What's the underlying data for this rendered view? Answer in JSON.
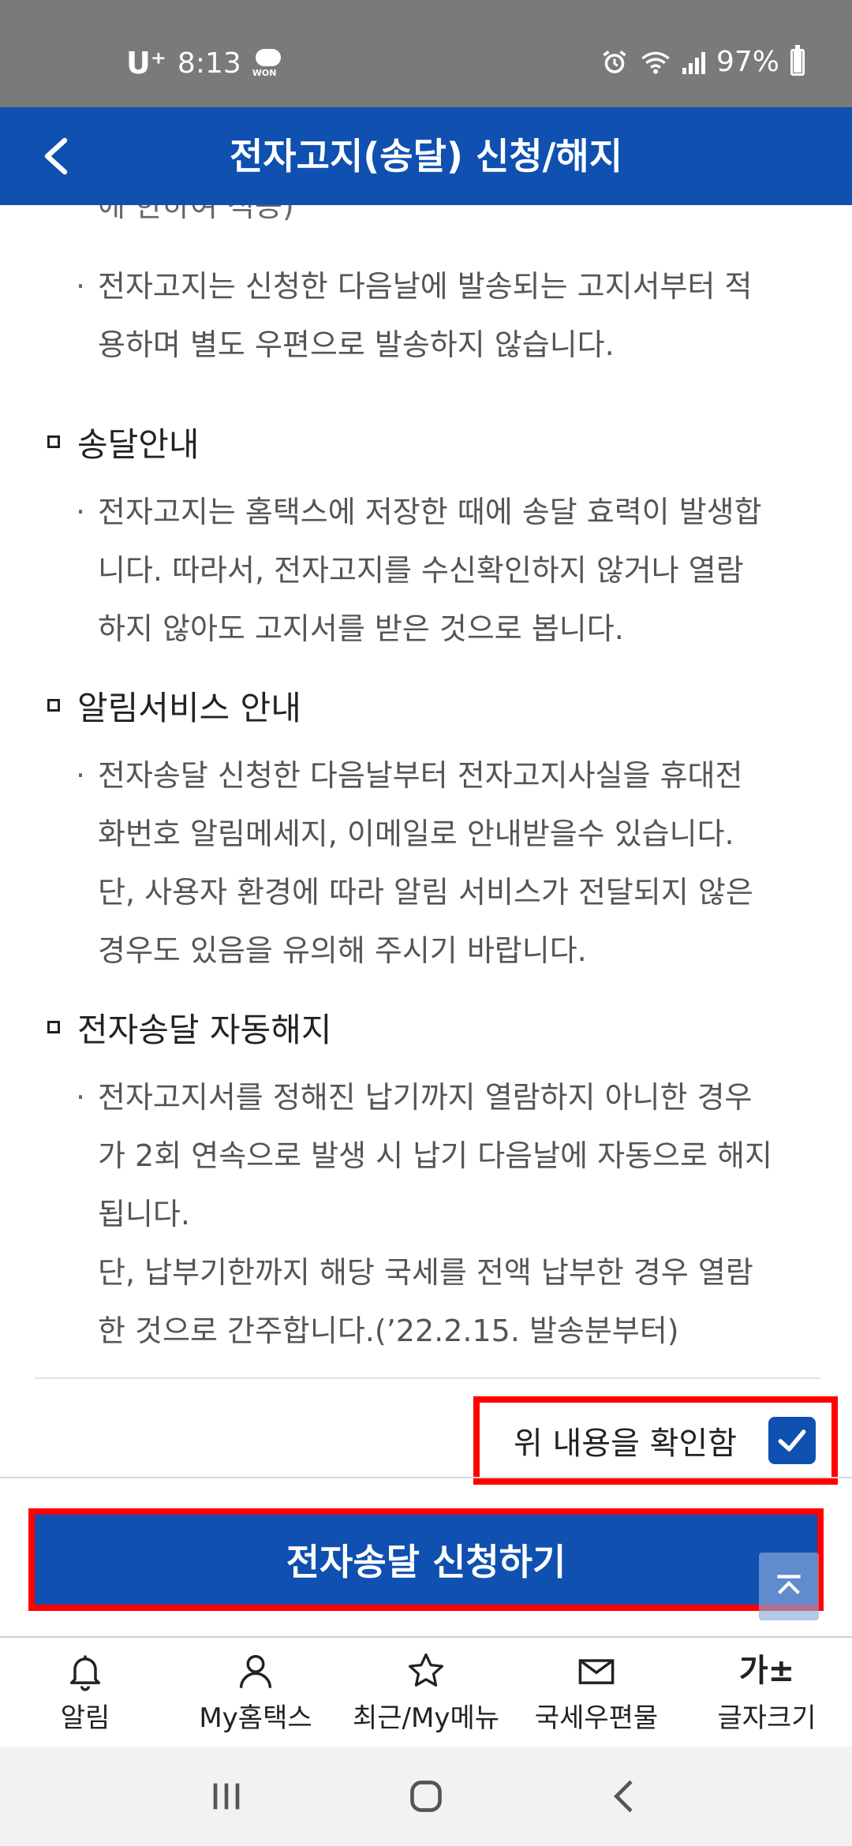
{
  "status_bar": {
    "carrier": "U⁺",
    "time": "8:13",
    "won_label": "WON",
    "battery": "97%",
    "battery_level": 0.97
  },
  "header": {
    "title": "전자고지(송달) 신청/해지"
  },
  "content": {
    "partial_line": "에 한하여 적용)",
    "intro_bullet": {
      "mark": "·",
      "lines": [
        "전자고지는 신청한 다음날에 발송되는 고지서부터 적",
        "용하며 별도 우편으로 발송하지 않습니다."
      ]
    },
    "sections": [
      {
        "title": "송달안내",
        "bullet_lines": [
          "전자고지는 홈택스에 저장한 때에 송달 효력이 발생합",
          "니다. 따라서, 전자고지를 수신확인하지 않거나 열람",
          "하지 않아도 고지서를 받은 것으로 봅니다."
        ]
      },
      {
        "title": "알림서비스 안내",
        "bullet_lines": [
          "전자송달 신청한 다음날부터 전자고지사실을 휴대전",
          "화번호 알림메세지, 이메일로 안내받을수 있습니다.",
          "단, 사용자 환경에 따라 알림 서비스가 전달되지 않은",
          "경우도 있음을 유의해 주시기 바랍니다."
        ]
      },
      {
        "title": "전자송달 자동해지",
        "bullet_lines": [
          "전자고지서를 정해진 납기까지 열람하지 아니한 경우",
          "가 2회 연속으로 발생 시 납기 다음날에 자동으로 해지",
          "됩니다.",
          "단, 납부기한까지 해당 국세를 전액 납부한 경우 열람",
          "한 것으로 간주합니다.(’22.2.15. 발송분부터)"
        ]
      }
    ]
  },
  "confirm": {
    "label": "위 내용을 확인함",
    "checked": true
  },
  "submit": {
    "label": "전자송달 신청하기"
  },
  "bottom_nav": {
    "items": [
      {
        "label": "알림",
        "icon": "bell-icon"
      },
      {
        "label": "My홈택스",
        "icon": "user-icon"
      },
      {
        "label": "최근/My메뉴",
        "icon": "star-icon"
      },
      {
        "label": "국세우편물",
        "icon": "mail-icon"
      },
      {
        "label": "글자크기",
        "icon_text": "가±",
        "icon": "font-size-icon"
      }
    ]
  },
  "colors": {
    "brand_blue": "#0f50b0",
    "highlight_red": "#ff0000",
    "status_bar_gray": "#7a7a7a"
  }
}
